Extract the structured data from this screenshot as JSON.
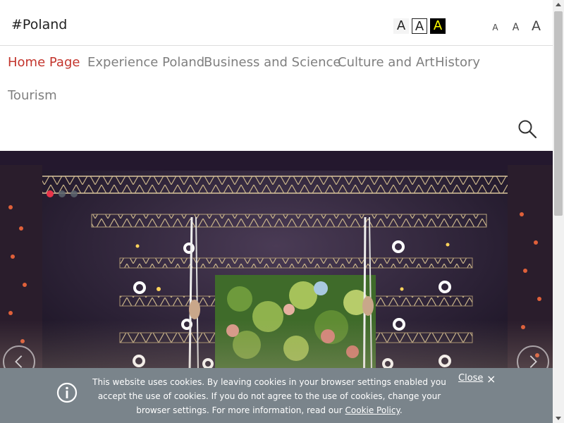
{
  "header": {
    "logo": "#Poland",
    "contrast": {
      "normal": "A",
      "outline": "A",
      "yellow": "A"
    },
    "font_sizes": {
      "small": "A",
      "medium": "A",
      "large": "A"
    }
  },
  "nav": {
    "items": [
      {
        "label": "Home Page"
      },
      {
        "label": "Experience Poland"
      },
      {
        "label": "Business and Science"
      },
      {
        "label": "Culture and Art"
      },
      {
        "label": "History"
      },
      {
        "label": "Tourism"
      }
    ],
    "active_color": "#c3352d"
  },
  "slider": {
    "slide_count": 3,
    "active_index": 0
  },
  "cookie": {
    "text_before_link": "This website uses cookies. By leaving cookies in your browser settings enabled you accept the use of cookies. If you do not agree to the use of cookies, change your browser settings. For more information, read our ",
    "link_label": "Cookie Policy",
    "text_after_link": ".",
    "close_label": "Close",
    "close_icon": "×"
  }
}
